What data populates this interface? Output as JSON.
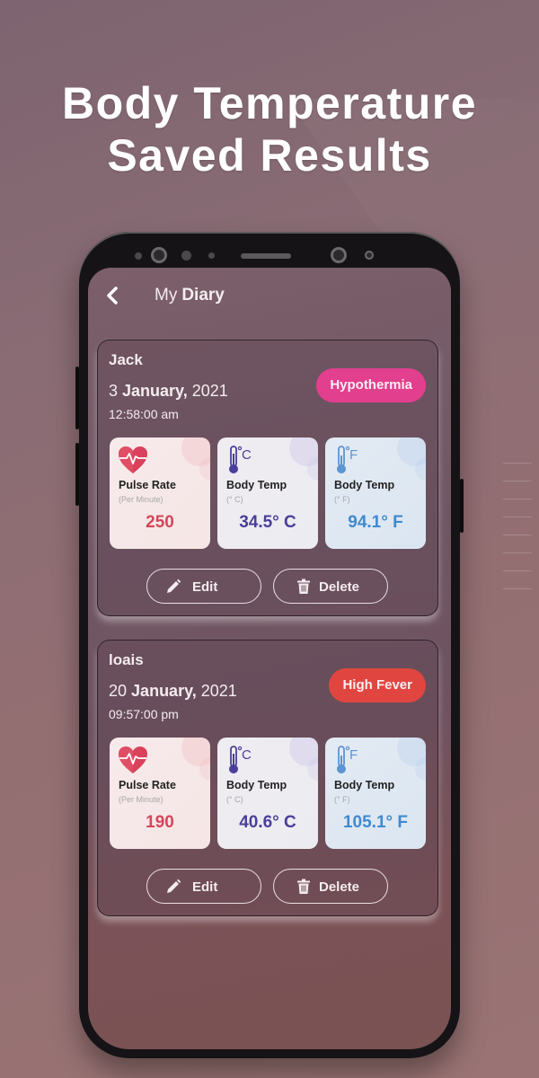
{
  "promo": {
    "headline_line1": "Body Temperature",
    "headline_line2": "Saved Results"
  },
  "header": {
    "back_icon": "chevron-left-icon",
    "title_prefix": "My",
    "title_main": "Diary"
  },
  "entries": [
    {
      "name": "Jack",
      "date_day": "3",
      "date_month": "January,",
      "date_year": "2021",
      "time": "12:58:00 am",
      "status": "Hypothermia",
      "status_color": "#e23f8e",
      "pulse": {
        "label": "Pulse Rate",
        "unit": "(Per Minute)",
        "value": "250",
        "icon": "heart-pulse-icon"
      },
      "temp_c": {
        "label": "Body Temp",
        "unit": "(° C)",
        "value": "34.5° C",
        "icon": "thermometer-celsius-icon"
      },
      "temp_f": {
        "label": "Body Temp",
        "unit": "(° F)",
        "value": "94.1° F",
        "icon": "thermometer-fahrenheit-icon"
      },
      "edit_label": "Edit",
      "delete_label": "Delete"
    },
    {
      "name": "loais",
      "date_day": "20",
      "date_month": "January,",
      "date_year": "2021",
      "time": "09:57:00 pm",
      "status": "High Fever",
      "status_color": "#e0463f",
      "pulse": {
        "label": "Pulse Rate",
        "unit": "(Per Minute)",
        "value": "190",
        "icon": "heart-pulse-icon"
      },
      "temp_c": {
        "label": "Body Temp",
        "unit": "(° C)",
        "value": "40.6° C",
        "icon": "thermometer-celsius-icon"
      },
      "temp_f": {
        "label": "Body Temp",
        "unit": "(° F)",
        "value": "105.1° F",
        "icon": "thermometer-fahrenheit-icon"
      },
      "edit_label": "Edit",
      "delete_label": "Delete"
    }
  ],
  "colors": {
    "pulse_value": "#d5465b",
    "celsius_value": "#4a3f9a",
    "fahrenheit_value": "#3f8ad0"
  }
}
